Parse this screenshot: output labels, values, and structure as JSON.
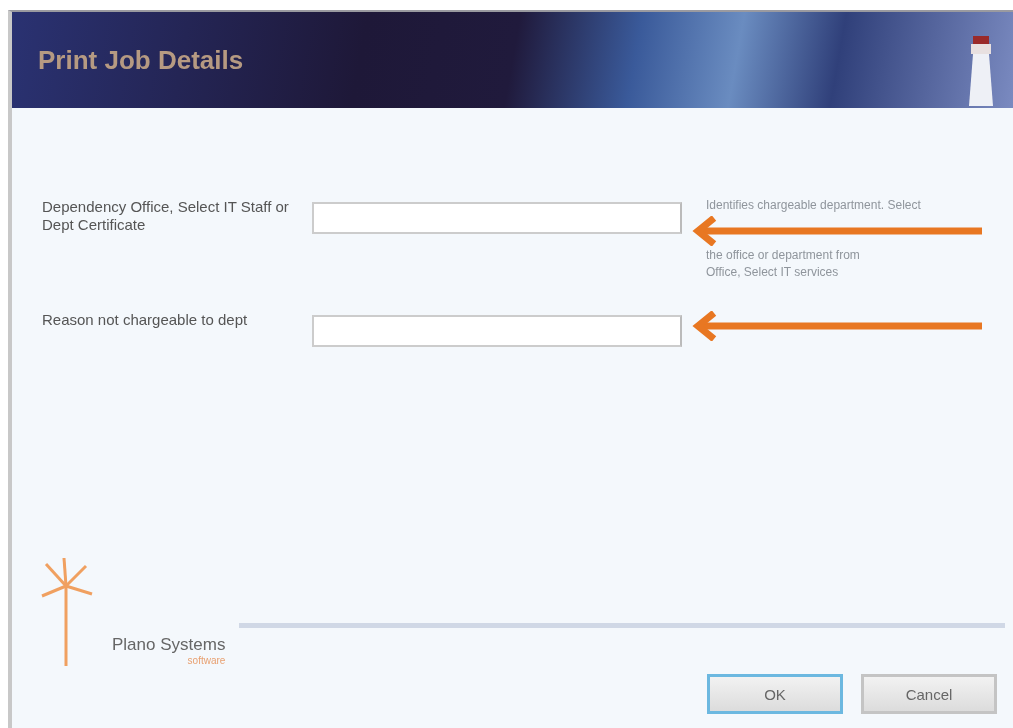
{
  "window": {
    "title": "Print Job Details"
  },
  "fields": [
    {
      "label": "Dependency Office, Select IT Staff or Dept Certificate",
      "hint_lines": [
        "Identifies chargeable department. Select",
        "the office or department from",
        "Office, Select IT services"
      ],
      "arrow": true
    },
    {
      "label": "Reason not chargeable to dept",
      "arrow": true
    }
  ],
  "footer": {
    "brand": "Plano Systems",
    "tagline": "software"
  },
  "buttons": [
    {
      "label": "OK",
      "default": true
    },
    {
      "label": "Cancel",
      "default": false
    }
  ]
}
